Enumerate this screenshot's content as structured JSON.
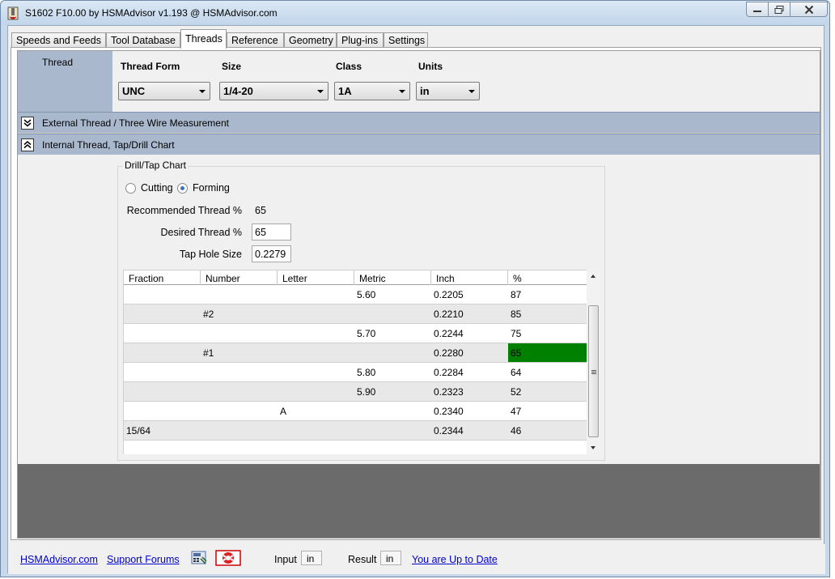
{
  "window": {
    "title": "S1602 F10.00 by HSMAdvisor v1.193 @ HSMAdvisor.com"
  },
  "tabs": [
    "Speeds and Feeds",
    "Tool Database",
    "Threads",
    "Reference",
    "Geometry",
    "Plug-ins",
    "Settings"
  ],
  "active_tab": "Threads",
  "thread_params": {
    "side_label": "Thread",
    "form_label": "Thread Form",
    "form_value": "UNC",
    "size_label": "Size",
    "size_value": "1/4-20",
    "class_label": "Class",
    "class_value": "1A",
    "units_label": "Units",
    "units_value": "in"
  },
  "sections": {
    "external": "External Thread / Three Wire Measurement",
    "internal": "Internal Thread, Tap/Drill Chart"
  },
  "drill_tap": {
    "legend": "Drill/Tap Chart",
    "radio_cutting": "Cutting",
    "radio_forming": "Forming",
    "selected_mode": "Forming",
    "recommended_label": "Recommended Thread %",
    "recommended_value": "65",
    "desired_label": "Desired Thread %",
    "desired_value": "65",
    "tap_hole_label": "Tap Hole Size",
    "tap_hole_value": "0.2279",
    "columns": [
      "Fraction",
      "Number",
      "Letter",
      "Metric",
      "Inch",
      "%"
    ],
    "rows": [
      [
        "",
        "",
        "",
        "5.60",
        "0.2205",
        "87"
      ],
      [
        "",
        "#2",
        "",
        "",
        "0.2210",
        "85"
      ],
      [
        "",
        "",
        "",
        "5.70",
        "0.2244",
        "75"
      ],
      [
        "",
        "#1",
        "",
        "",
        "0.2280",
        "65"
      ],
      [
        "",
        "",
        "",
        "5.80",
        "0.2284",
        "64"
      ],
      [
        "",
        "",
        "",
        "5.90",
        "0.2323",
        "52"
      ],
      [
        "",
        "",
        "A",
        "",
        "0.2340",
        "47"
      ],
      [
        "15/64",
        "",
        "",
        "",
        "0.2344",
        "46"
      ],
      [
        "",
        "",
        "",
        "",
        "",
        ""
      ]
    ],
    "highlight_row": 3,
    "highlight_color": "#008000"
  },
  "statusbar": {
    "link_site": "HSMAdvisor.com",
    "link_support": "Support Forums",
    "input_label": "Input",
    "input_value": "in",
    "result_label": "Result",
    "result_value": "in",
    "update_link": "You are Up to Date"
  },
  "colors": {
    "section_header": "#a9b8cd",
    "link": "#0000cc",
    "dark_area": "#6b6b6b"
  }
}
